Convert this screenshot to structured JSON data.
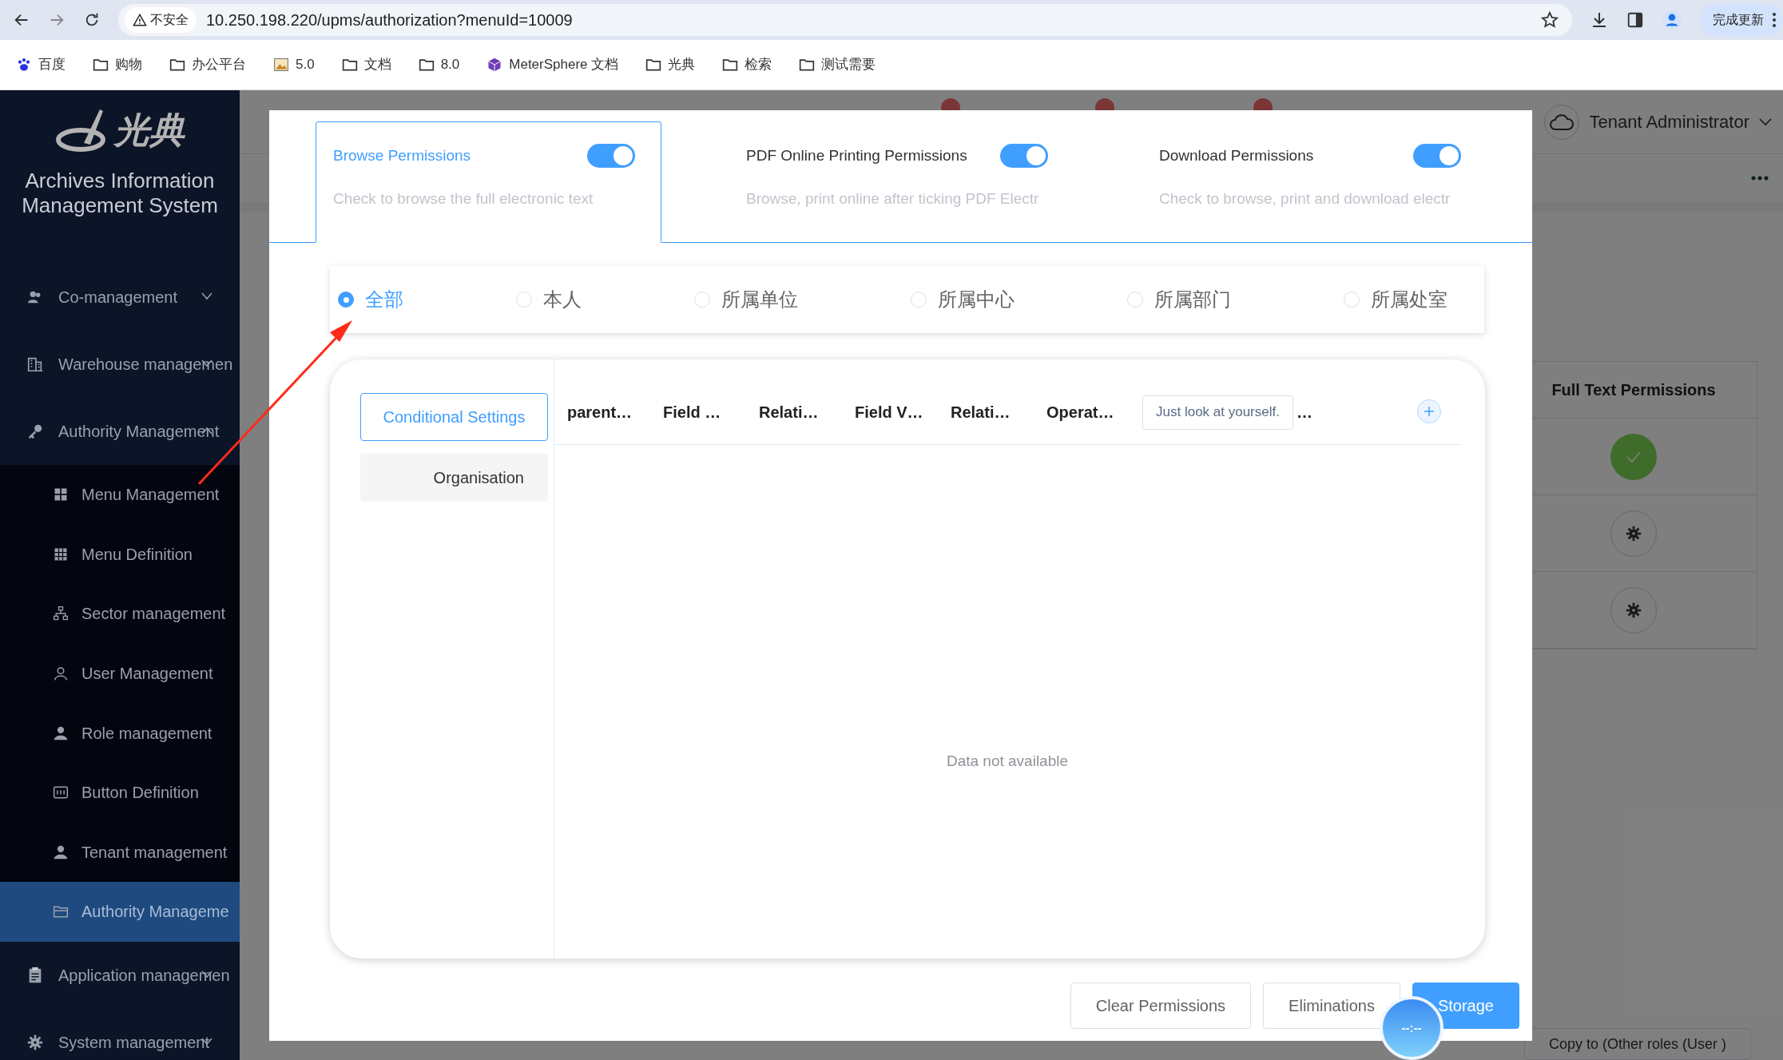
{
  "browser": {
    "security_label": "不安全",
    "url": "10.250.198.220/upms/authorization?menuId=10009",
    "update_button": "完成更新",
    "bookmarks": [
      {
        "label": "百度",
        "kind": "paw"
      },
      {
        "label": "购物",
        "kind": "folder"
      },
      {
        "label": "办公平台",
        "kind": "folder"
      },
      {
        "label": "5.0",
        "kind": "image"
      },
      {
        "label": "文档",
        "kind": "folder"
      },
      {
        "label": "8.0",
        "kind": "folder"
      },
      {
        "label": "MeterSphere 文档",
        "kind": "cube"
      },
      {
        "label": "光典",
        "kind": "folder"
      },
      {
        "label": "检索",
        "kind": "folder"
      },
      {
        "label": "测试需要",
        "kind": "folder"
      }
    ]
  },
  "sidebar": {
    "logo_text": "光典",
    "title": "Archives Information Management System",
    "items": [
      {
        "label": "Co-management",
        "expanded": false
      },
      {
        "label": "Warehouse managemen",
        "expanded": false
      },
      {
        "label": "Authority Management",
        "expanded": true,
        "children": [
          {
            "label": "Menu Management",
            "selected": false
          },
          {
            "label": "Menu Definition",
            "selected": false
          },
          {
            "label": "Sector management",
            "selected": false
          },
          {
            "label": "User Management",
            "selected": false
          },
          {
            "label": "Role management",
            "selected": false
          },
          {
            "label": "Button Definition",
            "selected": false
          },
          {
            "label": "Tenant management",
            "selected": false
          },
          {
            "label": "Authority Manageme",
            "selected": true
          }
        ]
      },
      {
        "label": "Application managemen",
        "expanded": false
      },
      {
        "label": "System management",
        "expanded": false
      }
    ]
  },
  "header": {
    "user": "Tenant Administrator"
  },
  "background_table": {
    "columns": [
      "Full Text Permissions"
    ],
    "rows": [
      {
        "kind": "check"
      },
      {
        "kind": "gear"
      },
      {
        "kind": "gear"
      }
    ],
    "copy_button": "Copy to (Other roles (User )"
  },
  "dialog": {
    "tabs": [
      {
        "title": "Browse Permissions",
        "description": "Check to browse the full electronic text",
        "on": true,
        "selected": true
      },
      {
        "title": "PDF Online Printing Permissions",
        "description": "Browse, print online after ticking PDF Electr",
        "on": true,
        "selected": false
      },
      {
        "title": "Download Permissions",
        "description": "Check to browse, print and download electr",
        "on": true,
        "selected": false
      }
    ],
    "scopes": [
      {
        "label": "全部",
        "selected": true
      },
      {
        "label": "本人",
        "selected": false
      },
      {
        "label": "所属单位",
        "selected": false
      },
      {
        "label": "所属中心",
        "selected": false
      },
      {
        "label": "所属部门",
        "selected": false
      },
      {
        "label": "所属处室",
        "selected": false
      }
    ],
    "conditions": [
      {
        "label": "Conditional Settings",
        "selected": true
      },
      {
        "label": "Organisation",
        "selected": false
      }
    ],
    "table": {
      "columns": [
        "parent…",
        "Field …",
        "Relati…",
        "Field V…",
        "Relati…",
        "Operat…"
      ],
      "tag": "Just look at yourself.",
      "more": "…",
      "empty_text": "Data not available"
    },
    "buttons": [
      {
        "label": "Clear Permissions",
        "kind": "default"
      },
      {
        "label": "Eliminations",
        "kind": "default"
      },
      {
        "label": "Storage",
        "kind": "primary"
      }
    ],
    "clock": "--:--"
  }
}
